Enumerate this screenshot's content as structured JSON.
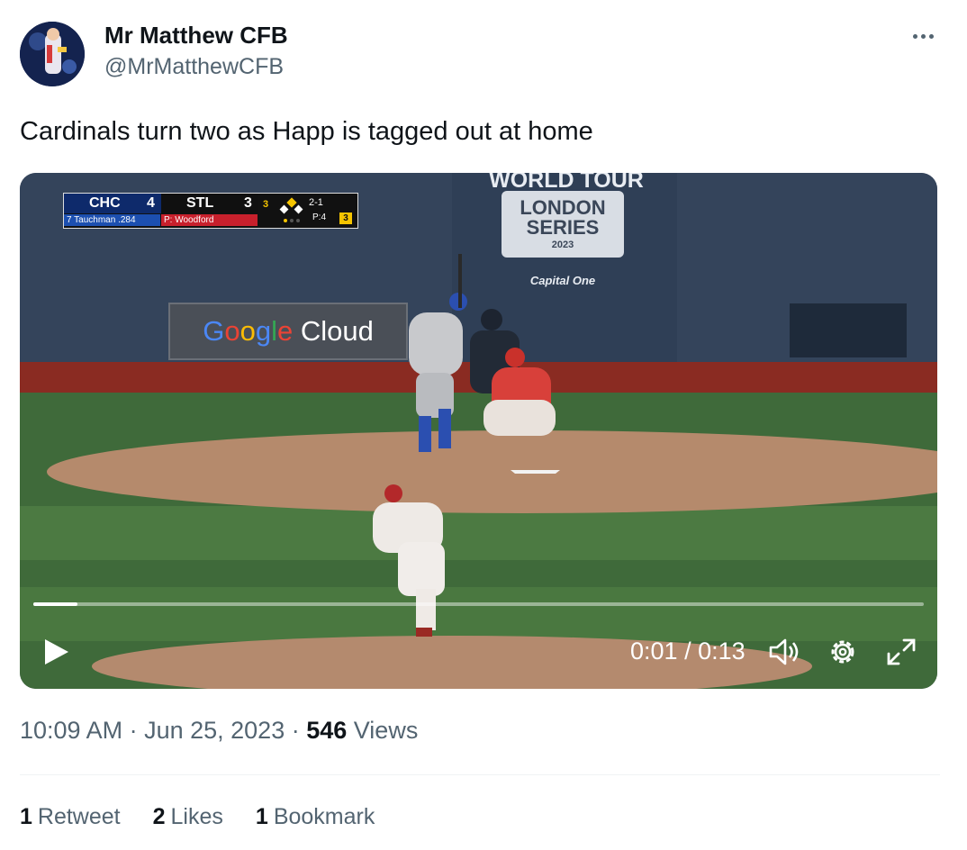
{
  "author": {
    "display_name": "Mr Matthew CFB",
    "handle": "@MrMatthewCFB",
    "avatar_icon": "avatar-image"
  },
  "tweet": {
    "text": "Cardinals turn two as Happ is tagged out at home"
  },
  "video": {
    "current_time": "0:01",
    "separator": "/",
    "duration": "0:13",
    "progress_fraction": 0.05,
    "scorebug": {
      "away_team": "CHC",
      "away_score": "4",
      "home_team": "STL",
      "home_score": "3",
      "away_sub": "7 Tauchman .284",
      "home_sub": "P: Woodford",
      "inning": "3",
      "count": "2-1",
      "pitch_count": "P:4",
      "outs": "3"
    },
    "scene_text": {
      "world_tour": "WORLD TOUR",
      "london": "LONDON",
      "series": "SERIES",
      "year": "2023",
      "capital_one": "Capital One",
      "google": [
        "G",
        "o",
        "o",
        "g",
        "l",
        "e"
      ],
      "cloud": " Cloud"
    }
  },
  "meta": {
    "time": "10:09 AM",
    "dot1": " · ",
    "date": "Jun 25, 2023",
    "dot2": " · ",
    "views_count": "546",
    "views_label": " Views"
  },
  "stats": {
    "retweet_count": "1",
    "retweet_label": "Retweet",
    "likes_count": "2",
    "likes_label": "Likes",
    "bookmark_count": "1",
    "bookmark_label": "Bookmark"
  },
  "colors": {
    "text_primary": "#0f1419",
    "text_secondary": "#536471",
    "divider": "#eff3f4"
  }
}
